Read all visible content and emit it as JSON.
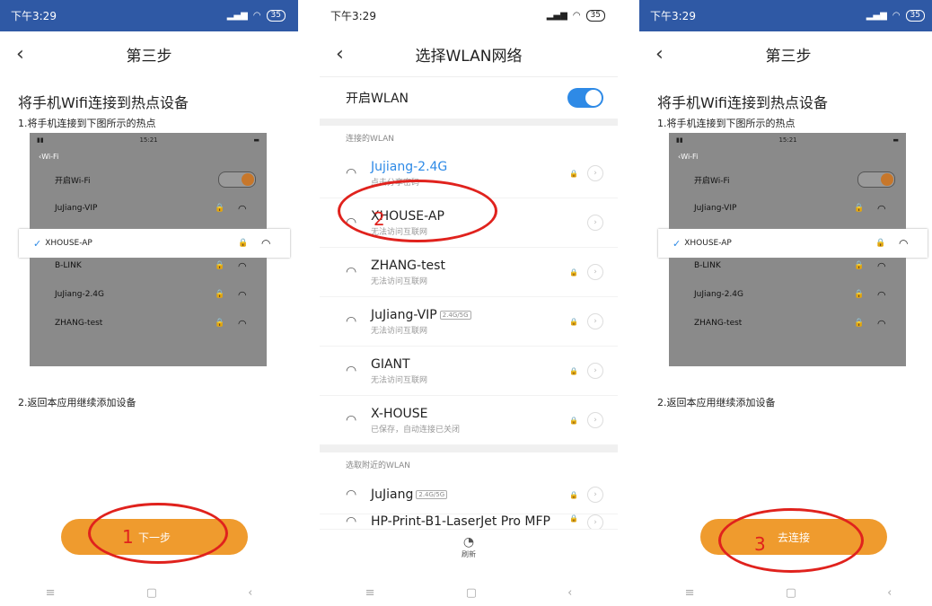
{
  "status": {
    "time": "下午3:29",
    "battery": "35"
  },
  "step_screen": {
    "title": "第三步",
    "heading": "将手机Wifi连接到热点设备",
    "step1": "1.将手机连接到下图所示的热点",
    "step2": "2.返回本应用继续添加设备",
    "inner": {
      "time": "15:21",
      "back": "Wi-Fi",
      "wifi_on": "开启Wi-Fi",
      "networks": [
        "JuJiang-VIP",
        "XHOUSE-AP",
        "B-LINK",
        "JuJiang-2.4G",
        "ZHANG-test"
      ],
      "selected": "XHOUSE-AP"
    }
  },
  "left": {
    "button": "下一步",
    "marker": "1"
  },
  "right": {
    "button": "去连接",
    "marker": "3"
  },
  "wlan_screen": {
    "title": "选择WLAN网络",
    "toggle_label": "开启WLAN",
    "toggle_on": true,
    "connected_header": "连接的WLAN",
    "nearby_header": "选取附近的WLAN",
    "networks": [
      {
        "name": "Jujiang-2.4G",
        "sub": "点击分享密码",
        "locked": true
      },
      {
        "name": "XHOUSE-AP",
        "sub": "无法访问互联网",
        "locked": false
      },
      {
        "name": "ZHANG-test",
        "sub": "无法访问互联网",
        "locked": true
      },
      {
        "name": "JuJiang-VIP",
        "badge": "2.4G/5G",
        "sub": "无法访问互联网",
        "locked": true
      },
      {
        "name": "GIANT",
        "sub": "无法访问互联网",
        "locked": true
      },
      {
        "name": "X-HOUSE",
        "sub": "已保存，自动连接已关闭",
        "locked": true
      }
    ],
    "nearby": [
      {
        "name": "JuJiang",
        "badge": "2.4G/5G",
        "locked": true
      },
      {
        "name": "HP-Print-B1-LaserJet Pro MFP",
        "locked": true
      }
    ],
    "refresh": "刷新",
    "marker": "2"
  },
  "sysnav": {
    "menu": "≡",
    "home": "▢",
    "back": "‹"
  },
  "colors": {
    "accent": "#ef9b2e",
    "header": "#2f59a5",
    "annotation": "#e0221d",
    "toggle": "#2e8ae6"
  }
}
